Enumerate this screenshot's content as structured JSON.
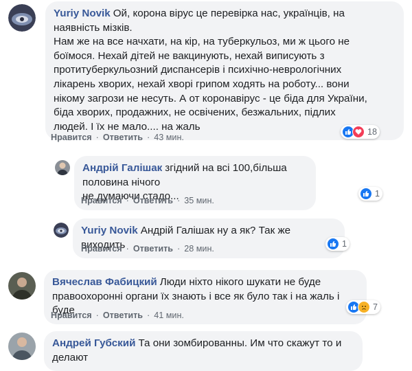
{
  "comments": [
    {
      "author": "Yuriy Novik",
      "text": "Ой, корона вірус це перевірка нас, українців, на\nнаявність мізків.\nНам же на все начхати, на кір, на туберкульоз, ми ж цього не\nбоїмося. Нехай дітей не вакцинують, нехай виписують з\nпротитуберкульозний диспансерів і психічно-неврологічних\nлікарень хворих, нехай хворі грипом ходять на роботу... вони\nнікому загрози не несуть. А от коронавірус - це біда для України,\nбіда хворих, продажних, не освічених, безжальних, підлих\nлюдей. І їх не мало.... на жаль",
      "like_label": "Нравится",
      "reply_label": "Ответить",
      "time": "43 мин.",
      "reactions": [
        "like-icon",
        "love-icon"
      ],
      "reaction_count": "18"
    },
    {
      "author": "Андрій Галішак",
      "text": "згідний на всі 100,більша половина нічого\nне думаючи стадо...",
      "like_label": "Нравится",
      "reply_label": "Ответить",
      "time": "35 мин.",
      "reactions": [
        "like-icon"
      ],
      "reaction_count": "1"
    },
    {
      "author": "Yuriy Novik",
      "text": "Андрій Галішак ну а як? Так же виходить",
      "like_label": "Нравится",
      "reply_label": "Ответить",
      "time": "28 мин.",
      "reactions": [
        "like-icon"
      ],
      "reaction_count": "1"
    },
    {
      "author": "Вячеслав Фабицкий",
      "text": "Люди ніхто нікого шукати не буде\nправоохоронні органи їх знають і все як було так і на жаль і буде",
      "like_label": "Нравится",
      "reply_label": "Ответить",
      "time": "41 мин.",
      "reactions": [
        "like-icon",
        "sad-icon"
      ],
      "reaction_count": "7"
    },
    {
      "author": "Андрей Губский",
      "text": "Та они зомбированны. Им что скажут то и\nделают"
    }
  ],
  "colors": {
    "author": "#385898",
    "bubble": "#f2f3f5",
    "like": "#1877f2",
    "love": "#f33e58",
    "sad": "#f7b125"
  }
}
